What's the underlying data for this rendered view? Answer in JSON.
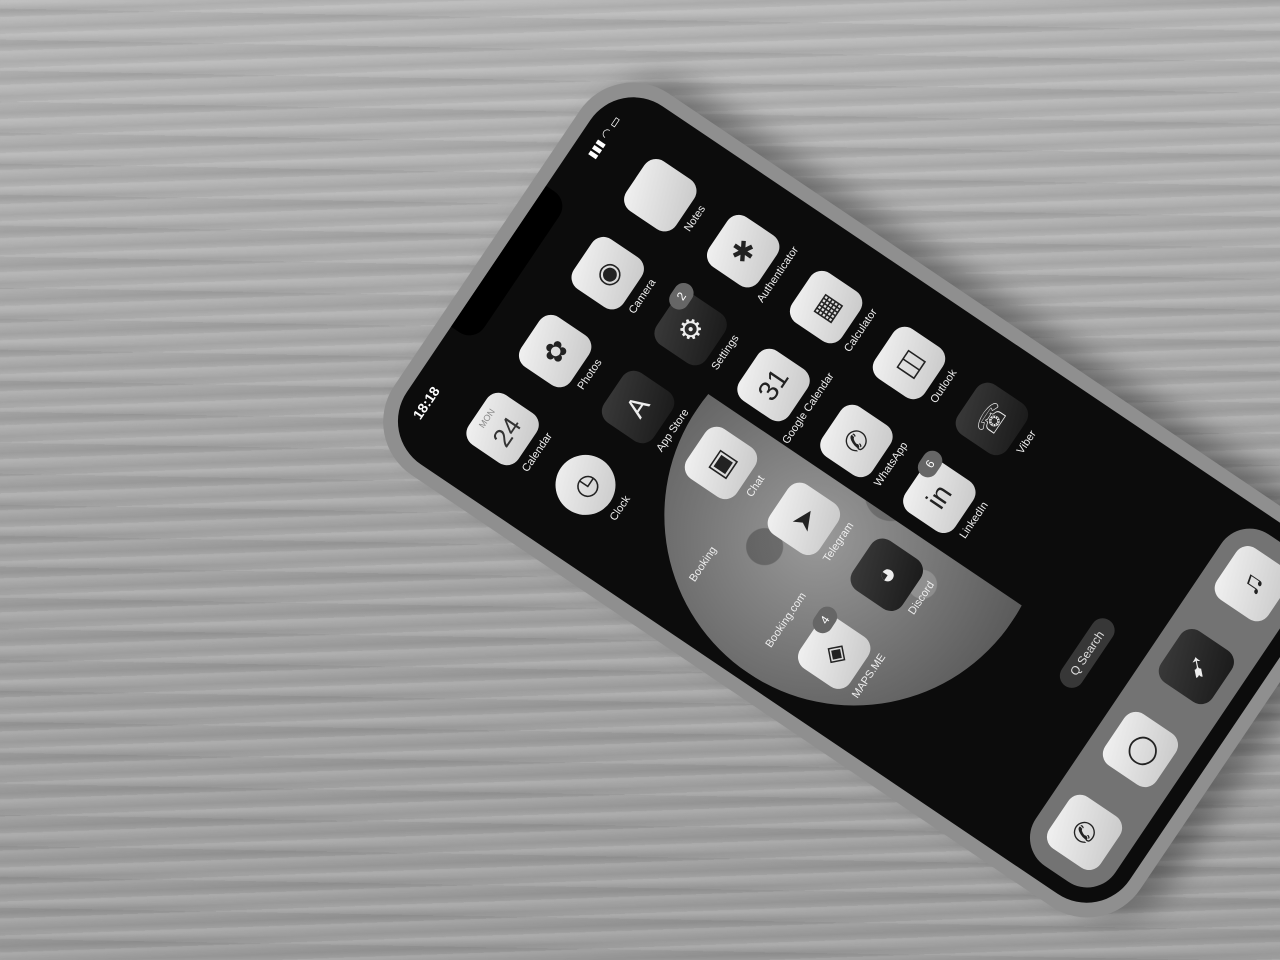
{
  "status_bar": {
    "time": "18:18",
    "icons": "▮▮▮ ◠ ▭"
  },
  "apps": [
    {
      "id": "calendar",
      "label": "Calendar",
      "day": "MON",
      "date": "24",
      "style": "light"
    },
    {
      "id": "photos",
      "label": "Photos",
      "glyph": "✿",
      "style": "light"
    },
    {
      "id": "camera",
      "label": "Camera",
      "glyph": "◉",
      "style": "light"
    },
    {
      "id": "notes",
      "label": "Notes",
      "glyph": "",
      "style": "light"
    },
    {
      "id": "clock",
      "label": "Clock",
      "glyph": "◷",
      "style": "round"
    },
    {
      "id": "app-store",
      "label": "App Store",
      "glyph": "A",
      "style": "dark"
    },
    {
      "id": "settings",
      "label": "Settings",
      "glyph": "⚙",
      "style": "dark",
      "badge": "2"
    },
    {
      "id": "authenticator",
      "label": "Authenticator",
      "glyph": "✱",
      "style": "light"
    },
    {
      "id": "booking",
      "label": "Booking",
      "glyph": "",
      "style": "empty"
    },
    {
      "id": "chat",
      "label": "Chat",
      "glyph": "▣",
      "style": "light"
    },
    {
      "id": "google-calendar",
      "label": "Google Calendar",
      "glyph": "31",
      "style": "light"
    },
    {
      "id": "calculator",
      "label": "Calculator",
      "glyph": "▦",
      "style": "light"
    },
    {
      "id": "booking-com",
      "label": "Booking.com",
      "glyph": "",
      "style": "empty"
    },
    {
      "id": "telegram",
      "label": "Telegram",
      "glyph": "➤",
      "style": "light"
    },
    {
      "id": "whatsapp",
      "label": "WhatsApp",
      "glyph": "✆",
      "style": "light"
    },
    {
      "id": "outlook",
      "label": "Outlook",
      "glyph": "◫",
      "style": "light"
    },
    {
      "id": "maps-me",
      "label": "MAPS.ME",
      "glyph": "◈",
      "style": "light",
      "badge": "4"
    },
    {
      "id": "discord",
      "label": "Discord",
      "glyph": "◕",
      "style": "dark"
    },
    {
      "id": "linkedin",
      "label": "LinkedIn",
      "glyph": "in",
      "style": "light",
      "badge": "6"
    },
    {
      "id": "viber",
      "label": "Viber",
      "glyph": "☏",
      "style": "dark"
    }
  ],
  "search": {
    "label": "Q Search"
  },
  "dock": [
    {
      "id": "phone",
      "glyph": "✆"
    },
    {
      "id": "messages",
      "glyph": "◯"
    },
    {
      "id": "safari",
      "glyph": "➹"
    },
    {
      "id": "music",
      "glyph": "♫"
    }
  ]
}
